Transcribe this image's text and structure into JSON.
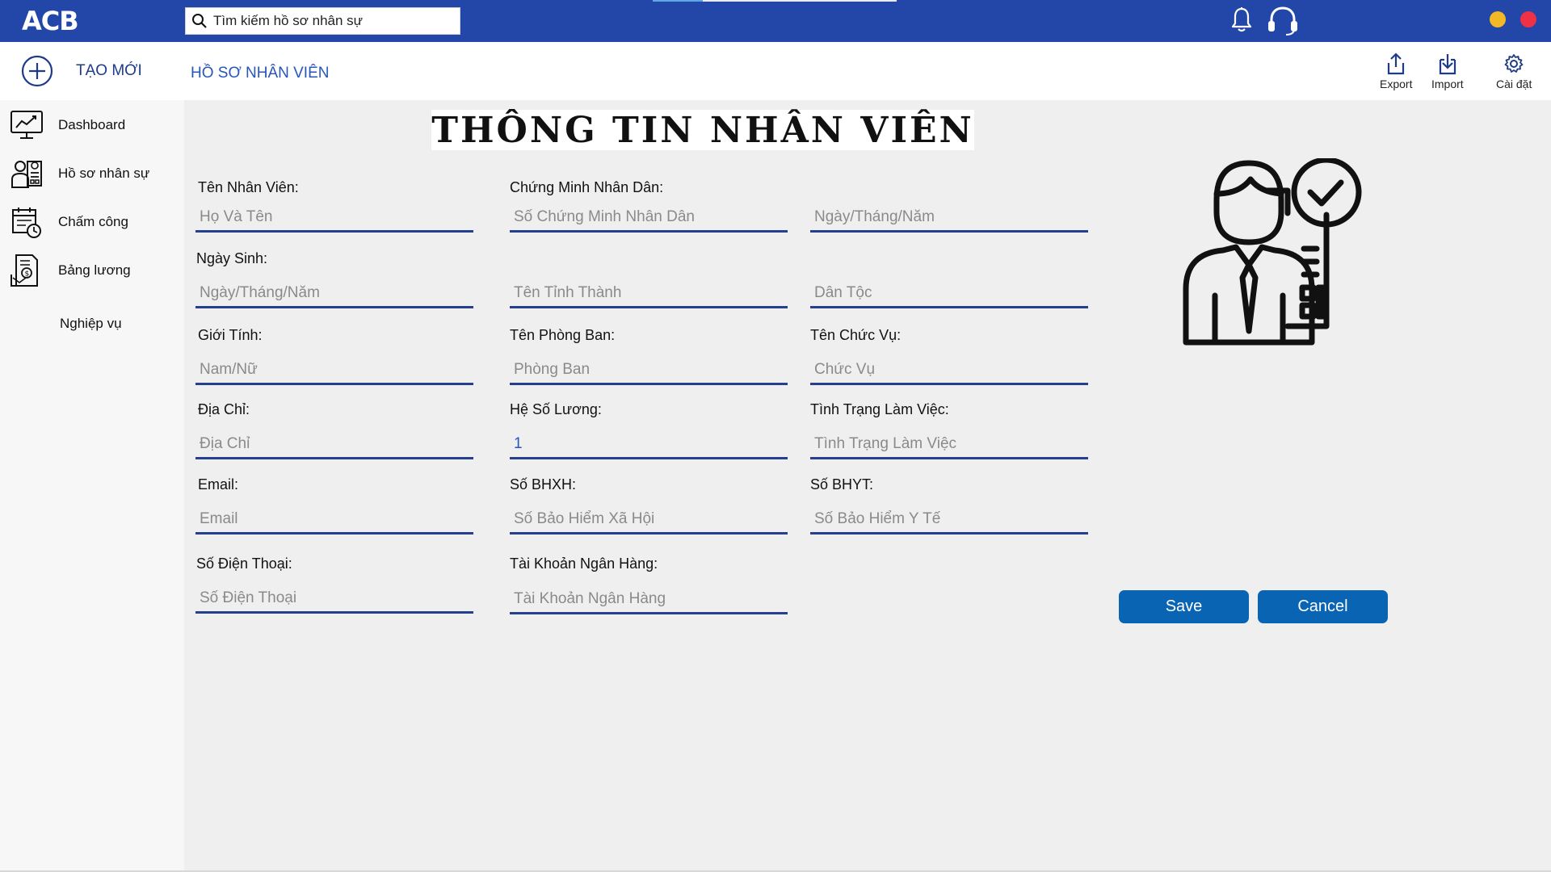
{
  "app": {
    "logo": "ACB"
  },
  "search": {
    "placeholder": "Tìm kiếm hồ sơ nhân sự"
  },
  "toolbar": {
    "new_label": "TẠO MỚI",
    "tab_label": "HỒ SƠ NHÂN VIÊN",
    "export_label": "Export",
    "import_label": "Import",
    "settings_label": "Cài đặt"
  },
  "sidebar": {
    "items": [
      {
        "label": "Dashboard",
        "icon": "chart-monitor-icon"
      },
      {
        "label": "Hồ sơ nhân sự",
        "icon": "employee-profile-icon"
      },
      {
        "label": "Chấm công",
        "icon": "calendar-clock-icon"
      },
      {
        "label": "Bảng lương",
        "icon": "payroll-icon"
      },
      {
        "label": "Nghiệp vụ",
        "icon": ""
      }
    ]
  },
  "form": {
    "title": "THÔNG TIN NHÂN VIÊN",
    "labels": {
      "name": "Tên Nhân Viên:",
      "id_card": "Chứng Minh Nhân Dân:",
      "dob": "Ngày Sinh:",
      "gender": "Giới Tính:",
      "department": "Tên Phòng Ban:",
      "position": "Tên Chức Vụ:",
      "address": "Địa Chỉ:",
      "salary_coef": "Hệ Số Lương:",
      "work_status": "Tình Trạng Làm Việc:",
      "email": "Email:",
      "social_ins": "Số BHXH:",
      "health_ins": "Số BHYT:",
      "phone": "Số Điện Thoại:",
      "bank": "Tài Khoản Ngân Hàng:"
    },
    "placeholders": {
      "name": "Họ Và Tên",
      "id_card": "Số Chứng Minh Nhân Dân",
      "id_date": "Ngày/Tháng/Năm",
      "dob": "Ngày/Tháng/Năm",
      "province": "Tên Tỉnh Thành",
      "ethnicity": "Dân Tộc",
      "gender": "Nam/Nữ",
      "department": "Phòng Ban",
      "position": "Chức Vụ",
      "address": "Địa Chỉ",
      "work_status": "Tình Trạng Làm Việc",
      "email": "Email",
      "social_ins": "Số Bảo Hiểm Xã Hội",
      "health_ins": "Số Bảo Hiểm Y Tế",
      "phone": "Số Điện Thoại",
      "bank": "Tài Khoản Ngân Hàng"
    },
    "values": {
      "salary_coef": "1"
    },
    "save_label": "Save",
    "cancel_label": "Cancel"
  },
  "colors": {
    "header": "#2347a8",
    "accent": "#25408f",
    "button": "#0a64b4"
  }
}
